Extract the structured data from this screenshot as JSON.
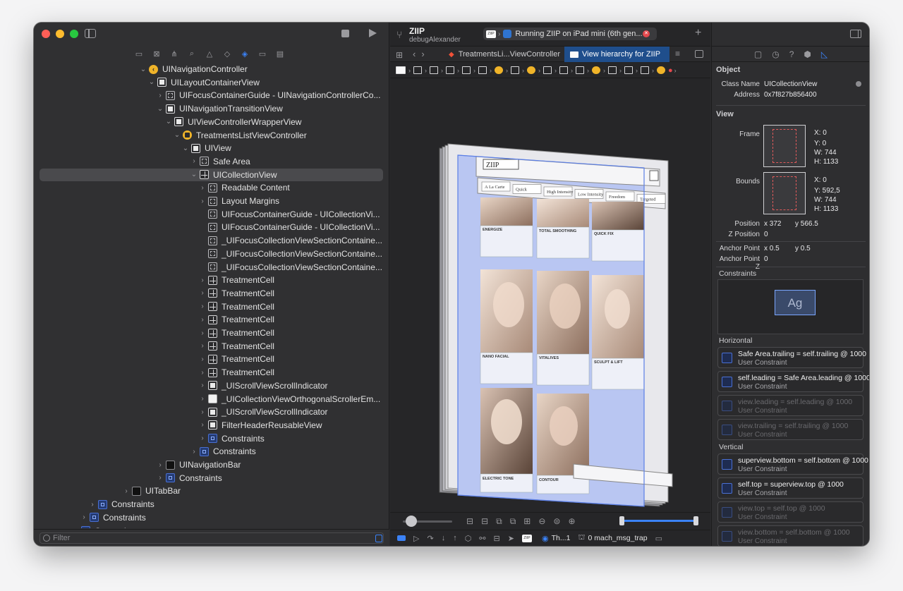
{
  "left": {
    "filter_placeholder": "Filter",
    "tree": [
      {
        "label": "UINavigationController",
        "indent": 150,
        "disc": "⌄",
        "icon": "nav"
      },
      {
        "label": "UILayoutContainerView",
        "indent": 162,
        "disc": "⌄",
        "icon": "square"
      },
      {
        "label": "UIFocusContainerGuide - UINavigationControllerCo...",
        "indent": 174,
        "disc": "›",
        "icon": "guide"
      },
      {
        "label": "UINavigationTransitionView",
        "indent": 174,
        "disc": "⌄",
        "icon": "square"
      },
      {
        "label": "UIViewControllerWrapperView",
        "indent": 186,
        "disc": "⌄",
        "icon": "square"
      },
      {
        "label": "TreatmentsListViewController",
        "indent": 198,
        "disc": "⌄",
        "icon": "vc"
      },
      {
        "label": "UIView",
        "indent": 210,
        "disc": "⌄",
        "icon": "square"
      },
      {
        "label": "Safe Area",
        "indent": 222,
        "disc": "›",
        "icon": "guide"
      },
      {
        "label": "UICollectionView",
        "indent": 222,
        "disc": "⌄",
        "icon": "grid",
        "selected": true
      },
      {
        "label": "Readable Content",
        "indent": 234,
        "disc": "›",
        "icon": "guide"
      },
      {
        "label": "Layout Margins",
        "indent": 234,
        "disc": "›",
        "icon": "guide"
      },
      {
        "label": "UIFocusContainerGuide - UICollectionVi...",
        "indent": 234,
        "disc": "",
        "icon": "guide"
      },
      {
        "label": "UIFocusContainerGuide - UICollectionVi...",
        "indent": 234,
        "disc": "",
        "icon": "guide"
      },
      {
        "label": "_UIFocusCollectionViewSectionContaine...",
        "indent": 234,
        "disc": "",
        "icon": "guide"
      },
      {
        "label": "_UIFocusCollectionViewSectionContaine...",
        "indent": 234,
        "disc": "",
        "icon": "guide"
      },
      {
        "label": "_UIFocusCollectionViewSectionContaine...",
        "indent": 234,
        "disc": "",
        "icon": "guide"
      },
      {
        "label": "TreatmentCell",
        "indent": 234,
        "disc": "›",
        "icon": "grid"
      },
      {
        "label": "TreatmentCell",
        "indent": 234,
        "disc": "›",
        "icon": "grid"
      },
      {
        "label": "TreatmentCell",
        "indent": 234,
        "disc": "›",
        "icon": "grid"
      },
      {
        "label": "TreatmentCell",
        "indent": 234,
        "disc": "›",
        "icon": "grid"
      },
      {
        "label": "TreatmentCell",
        "indent": 234,
        "disc": "›",
        "icon": "grid"
      },
      {
        "label": "TreatmentCell",
        "indent": 234,
        "disc": "›",
        "icon": "grid"
      },
      {
        "label": "TreatmentCell",
        "indent": 234,
        "disc": "›",
        "icon": "grid"
      },
      {
        "label": "TreatmentCell",
        "indent": 234,
        "disc": "›",
        "icon": "grid"
      },
      {
        "label": "_UIScrollViewScrollIndicator",
        "indent": 234,
        "disc": "›",
        "icon": "square"
      },
      {
        "label": "_UICollectionViewOrthogonalScrollerEm...",
        "indent": 234,
        "disc": "›",
        "icon": "white"
      },
      {
        "label": "_UIScrollViewScrollIndicator",
        "indent": 234,
        "disc": "›",
        "icon": "square"
      },
      {
        "label": "FilterHeaderReusableView",
        "indent": 234,
        "disc": "›",
        "icon": "square"
      },
      {
        "label": "Constraints",
        "indent": 234,
        "disc": "›",
        "icon": "constraint"
      },
      {
        "label": "Constraints",
        "indent": 222,
        "disc": "›",
        "icon": "constraint"
      },
      {
        "label": "UINavigationBar",
        "indent": 174,
        "disc": "›",
        "icon": "bar"
      },
      {
        "label": "Constraints",
        "indent": 174,
        "disc": "›",
        "icon": "constraint"
      },
      {
        "label": "UITabBar",
        "indent": 126,
        "disc": "›",
        "icon": "bar"
      },
      {
        "label": "Constraints",
        "indent": 78,
        "disc": "›",
        "icon": "constraint"
      },
      {
        "label": "Constraints",
        "indent": 66,
        "disc": "›",
        "icon": "constraint"
      },
      {
        "label": "Constraints",
        "indent": 54,
        "disc": "›",
        "icon": "constraint"
      }
    ]
  },
  "center": {
    "scheme_title": "ZIIP",
    "scheme_sub": "debugAlexander",
    "run_status": "Running ZIIP on iPad mini (6th gen...",
    "tab1": "TreatmentsLi...ViewController",
    "tab2": "View hierarchy for ZIIP",
    "thread_label": "Th...1",
    "frame_label": "0 mach_msg_trap",
    "app_logo": "ZIIP",
    "chips": [
      "A La Carte",
      "Quick",
      "High Intensity",
      "Low Intensity",
      "Freedom",
      "Targeted"
    ],
    "cell_titles": [
      "ENERGIZE",
      "TOTAL SMOOTHING",
      "QUICK FIX",
      "NANO FACIAL",
      "VITALIVES",
      "SCULPT & LIFT",
      "ELECTRIC TONE",
      "CONTOUR"
    ]
  },
  "inspector": {
    "object_title": "Object",
    "class_name_label": "Class Name",
    "class_name": "UICollectionView",
    "address_label": "Address",
    "address": "0x7f827b856400",
    "view_title": "View",
    "frame_label": "Frame",
    "frame": {
      "x": "X: 0",
      "y": "Y: 0",
      "w": "W: 744",
      "h": "H: 1133"
    },
    "bounds_label": "Bounds",
    "bounds": {
      "x": "X: 0",
      "y": "Y: 592,5",
      "w": "W: 744",
      "h": "H: 1133"
    },
    "position_label": "Position",
    "position_x": "x  372",
    "position_y": "y  566.5",
    "zpos_label": "Z Position",
    "zpos": "0",
    "anchor_label": "Anchor Point",
    "anchor_x": "x  0.5",
    "anchor_y": "y  0.5",
    "anchor_z_label": "Anchor Point Z",
    "anchor_z": "0",
    "constraints_title": "Constraints",
    "constraints_preview": "Ag",
    "horizontal_title": "Horizontal",
    "vertical_title": "Vertical",
    "horizontal": [
      {
        "expr": "Safe Area.trailing = self.trailing @ 1000",
        "kind": "User Constraint",
        "dim": false
      },
      {
        "expr": "self.leading = Safe Area.leading @ 1000",
        "kind": "User Constraint",
        "dim": false
      },
      {
        "expr": "view.leading = self.leading @ 1000",
        "kind": "User Constraint",
        "dim": true
      },
      {
        "expr": "view.trailing = self.trailing @ 1000",
        "kind": "User Constraint",
        "dim": true
      }
    ],
    "vertical": [
      {
        "expr": "superview.bottom = self.bottom @ 1000",
        "kind": "User Constraint",
        "dim": false
      },
      {
        "expr": "self.top = superview.top @ 1000",
        "kind": "User Constraint",
        "dim": false
      },
      {
        "expr": "view.top = self.top @ 1000",
        "kind": "User Constraint",
        "dim": true
      },
      {
        "expr": "view.bottom = self.bottom @ 1000",
        "kind": "User Constraint",
        "dim": true
      }
    ]
  }
}
